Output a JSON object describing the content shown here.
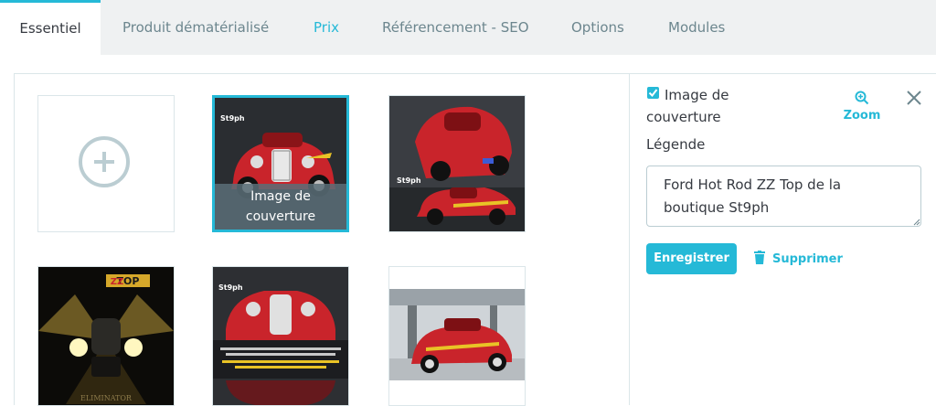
{
  "tabs": [
    {
      "label": "Essentiel"
    },
    {
      "label": "Produit dématérialisé"
    },
    {
      "label": "Prix"
    },
    {
      "label": "Référencement - SEO"
    },
    {
      "label": "Options"
    },
    {
      "label": "Modules"
    }
  ],
  "active_tab": "Essentiel",
  "images": {
    "add_icon": "plus-circle-icon",
    "cover_overlay_label": "Image de couverture",
    "logo_text": "St9ph"
  },
  "sidebar": {
    "cover_checkbox_label": "Image de couverture",
    "cover_checked": true,
    "zoom_label": "Zoom",
    "legend_label": "Légende",
    "caption_value": "Ford Hot Rod ZZ Top de la boutique St9ph",
    "save_label": "Enregistrer",
    "delete_label": "Supprimer"
  },
  "colors": {
    "accent": "#25b9d7",
    "tab_bg": "#eff1f2",
    "text": "#363a41",
    "muted": "#6c868e"
  }
}
